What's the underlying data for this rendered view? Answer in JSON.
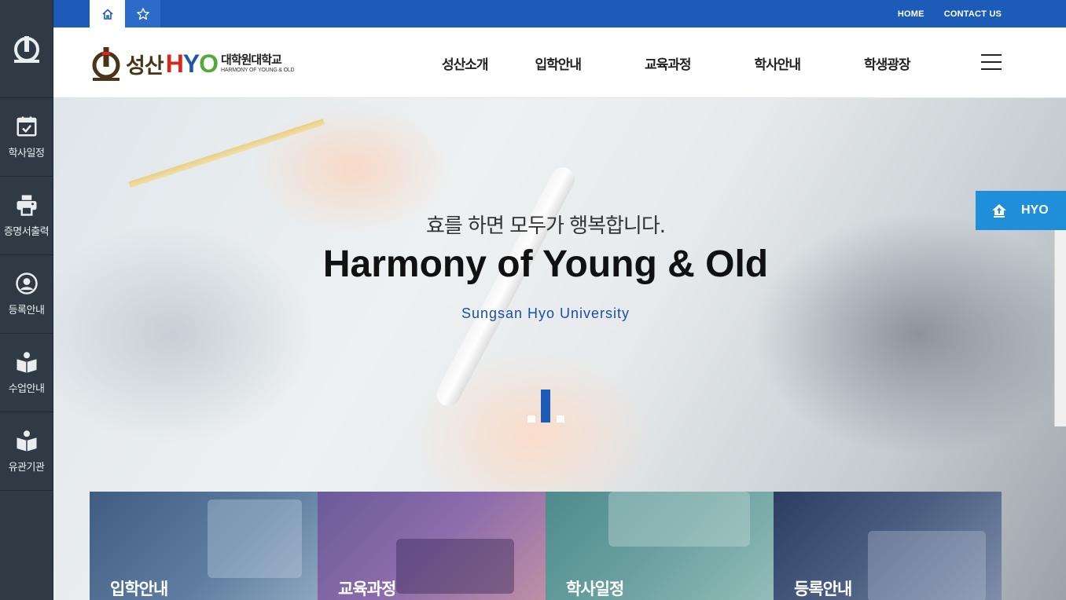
{
  "quickbar": {
    "items": [
      {
        "label": "학사일정",
        "icon": "calendar-check-icon"
      },
      {
        "label": "증명서출력",
        "icon": "printer-icon"
      },
      {
        "label": "등록안내",
        "icon": "user-circle-icon"
      },
      {
        "label": "수업안내",
        "icon": "book-reader-icon"
      },
      {
        "label": "유관기관",
        "icon": "book-reader-icon"
      }
    ]
  },
  "topbar": {
    "home_link": "HOME",
    "contact_link": "CONTACT US"
  },
  "header": {
    "logo": {
      "name_kr": "성산",
      "h": "H",
      "y": "Y",
      "o": "O",
      "sub_kr": "대학원대학교",
      "sub_en": "HARMONY OF YOUNG & OLD"
    },
    "nav": [
      "성산소개",
      "입학안내",
      "교육과정",
      "학사안내",
      "학생광장"
    ]
  },
  "hero": {
    "subtitle": "효를 하면 모두가 행복합니다.",
    "title": "Harmony of Young & Old",
    "tagline": "Sungsan Hyo University"
  },
  "float": {
    "label": "HYO"
  },
  "cards": [
    "입학안내",
    "교육과정",
    "학사일정",
    "등록안내"
  ],
  "colors": {
    "primary_blue": "#1c5cb8",
    "sidebar_bg": "#2f3a44",
    "float_blue": "#1f8fd9",
    "logo_red": "#d9251c",
    "logo_green": "#57a83a"
  }
}
